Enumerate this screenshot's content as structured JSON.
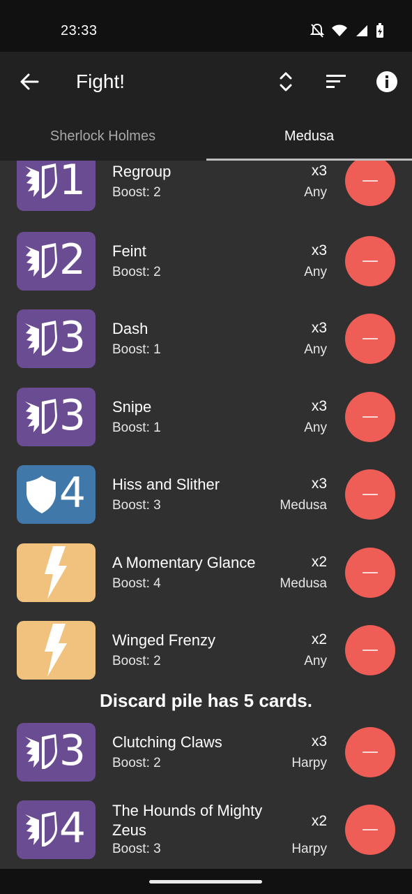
{
  "status_bar": {
    "time": "23:33"
  },
  "app_bar": {
    "title": "Fight!"
  },
  "tabs": [
    {
      "label": "Sherlock Holmes",
      "active": false
    },
    {
      "label": "Medusa",
      "active": true
    }
  ],
  "colors": {
    "purple": "#6a4c93",
    "blue": "#3f78a9",
    "orange": "#f1c27e",
    "remove": "#ef5e56"
  },
  "cards": [
    {
      "icon": "versatile-icon",
      "value": "1",
      "name": "Regroup",
      "boost": "Boost: 2",
      "qty": "x3",
      "owner": "Any"
    },
    {
      "icon": "versatile-icon",
      "value": "2",
      "name": "Feint",
      "boost": "Boost: 2",
      "qty": "x3",
      "owner": "Any"
    },
    {
      "icon": "versatile-icon",
      "value": "3",
      "name": "Dash",
      "boost": "Boost: 1",
      "qty": "x3",
      "owner": "Any"
    },
    {
      "icon": "versatile-icon",
      "value": "3",
      "name": "Snipe",
      "boost": "Boost: 1",
      "qty": "x3",
      "owner": "Any"
    },
    {
      "icon": "defense-shield-icon",
      "value": "4",
      "name": "Hiss and Slither",
      "boost": "Boost: 3",
      "qty": "x3",
      "owner": "Medusa"
    },
    {
      "icon": "scheme-lightning-icon",
      "value": "",
      "name": "A Momentary Glance",
      "boost": "Boost: 4",
      "qty": "x2",
      "owner": "Medusa"
    },
    {
      "icon": "scheme-lightning-icon",
      "value": "",
      "name": "Winged Frenzy",
      "boost": "Boost: 2",
      "qty": "x2",
      "owner": "Any"
    }
  ],
  "discard_label": "Discard pile has 5 cards.",
  "discard_cards": [
    {
      "icon": "versatile-icon",
      "value": "3",
      "name": "Clutching Claws",
      "boost": "Boost: 2",
      "qty": "x3",
      "owner": "Harpy"
    },
    {
      "icon": "versatile-icon",
      "value": "4",
      "name": "The Hounds of Mighty Zeus",
      "boost": "Boost: 3",
      "qty": "x2",
      "owner": "Harpy"
    }
  ]
}
